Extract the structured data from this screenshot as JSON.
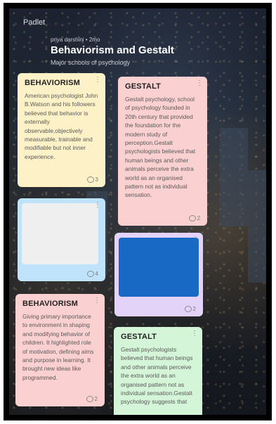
{
  "app": {
    "logo": "Padlet"
  },
  "header": {
    "meta": "priya darshini • 2mo",
    "title": "Behaviorism and Gestalt",
    "subtitle": "Major schools of psychology"
  },
  "cards": [
    {
      "title": "BEHAVIORISM",
      "body": "American psychologist John B.Watson and his followers believed that behavior is externally observable,objectively measurable, trainable and modifiable but not inner experience.",
      "comments": "3",
      "color": "#fdf2c7"
    },
    {
      "title": "GESTALT",
      "body": "Gestalt psychology, school of psychology founded in 20th century that provided the foundation for the modern study of perception.Gestalt psychologists believed that human beings and other animals perceive the extra world as an organised pattern not as individual sensation.",
      "comments": "2",
      "color": "#fbd0d0"
    },
    {
      "title": "",
      "body": "",
      "comments": "4",
      "color": "#bfe3fa"
    },
    {
      "title": "",
      "body": "",
      "comments": "2",
      "color": "#e3d3f8"
    },
    {
      "title": "BEHAVIORISM",
      "body": "Giving primary importance to environment in shaping and modifying behavior of children. It highlighted role of motivation, defining aims and purpose in learning. It brought new ideas like programmed.",
      "comments": "2",
      "color": "#fbd0d0"
    },
    {
      "title": "GESTALT",
      "body": "Gestalt psychologists believed that human beings and other animals perceive the extra world as an organised pattern not as individual sensation.Gestalt psychology suggests that",
      "comments": "",
      "color": "#d5f5d8"
    }
  ],
  "icons": {
    "more": "more-vertical-icon",
    "comment": "comment-bubble-icon"
  }
}
